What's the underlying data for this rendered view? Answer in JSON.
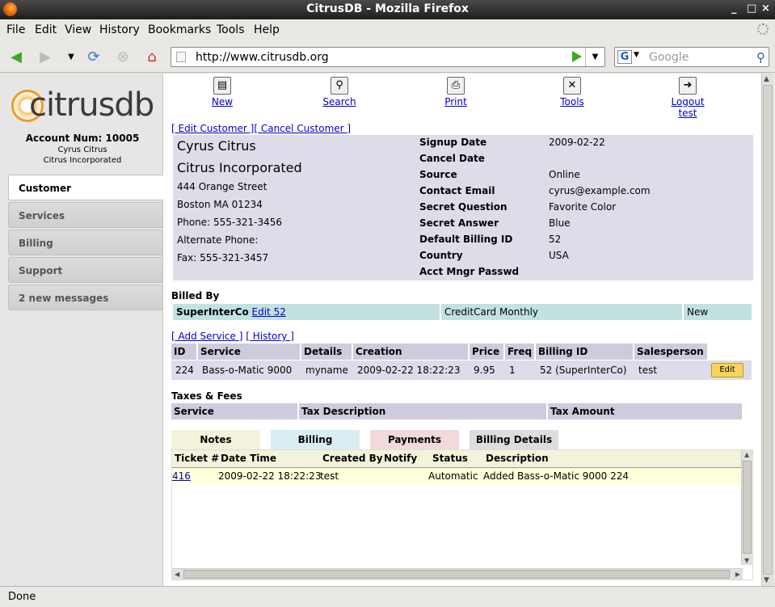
{
  "window": {
    "title": "CitrusDB - Mozilla Firefox"
  },
  "menu": [
    "File",
    "Edit",
    "View",
    "History",
    "Bookmarks",
    "Tools",
    "Help"
  ],
  "nav": {
    "url": "http://www.citrusdb.org",
    "search_placeholder": "Google"
  },
  "status": "Done",
  "sidebar": {
    "brand": "citrusdb",
    "account_label": "Account Num:",
    "account_num": "10005",
    "name": "Cyrus Citrus",
    "company": "Citrus Incorporated",
    "tabs": [
      {
        "label": "Customer"
      },
      {
        "label": "Services"
      },
      {
        "label": "Billing"
      },
      {
        "label": "Support"
      },
      {
        "label": "2 new messages"
      }
    ]
  },
  "toolbar": [
    {
      "label": "New"
    },
    {
      "label": "Search"
    },
    {
      "label": "Print"
    },
    {
      "label": "Tools"
    },
    {
      "label": "Logout test"
    }
  ],
  "customer_links": {
    "edit": "[ Edit Customer ]",
    "cancel": "[ Cancel Customer ]"
  },
  "customer": {
    "name": "Cyrus Citrus",
    "company": "Citrus Incorporated",
    "street": "444 Orange Street",
    "city": "Boston MA 01234",
    "phone": "Phone: 555-321-3456",
    "alt_phone": "Alternate Phone:",
    "fax": "Fax: 555-321-3457"
  },
  "details": [
    {
      "k": "Signup Date",
      "v": "2009-02-22"
    },
    {
      "k": "Cancel Date",
      "v": ""
    },
    {
      "k": "Source",
      "v": "Online"
    },
    {
      "k": "Contact Email",
      "v": "cyrus@example.com"
    },
    {
      "k": "Secret Question",
      "v": "Favorite Color"
    },
    {
      "k": "Secret Answer",
      "v": "Blue"
    },
    {
      "k": "Default Billing ID",
      "v": "52"
    },
    {
      "k": "Country",
      "v": "USA"
    },
    {
      "k": "Acct Mngr Passwd",
      "v": ""
    }
  ],
  "billed_by": {
    "heading": "Billed By",
    "org": "SuperInterCo",
    "edit_link": "Edit 52",
    "method": "CreditCard Monthly",
    "status": "New"
  },
  "service_links": {
    "add": "[ Add Service ]",
    "history": "[ History ]"
  },
  "services": {
    "headers": [
      "ID",
      "Service",
      "Details",
      "Creation",
      "Price",
      "Freq",
      "Billing ID",
      "Salesperson"
    ],
    "rows": [
      [
        "224",
        "Bass-o-Matic 9000",
        "myname",
        "2009-02-22 18:22:23",
        "9.95",
        "1",
        "52 (SuperInterCo)",
        "test"
      ]
    ],
    "edit_label": "Edit"
  },
  "taxes": {
    "heading": "Taxes & Fees",
    "headers": [
      "Service",
      "Tax Description",
      "Tax Amount"
    ]
  },
  "tabs": [
    {
      "label": "Notes",
      "color": "#f3f3dc"
    },
    {
      "label": "Billing",
      "color": "#d9eef2"
    },
    {
      "label": "Payments",
      "color": "#f2dada"
    },
    {
      "label": "Billing Details",
      "color": "#dddddd"
    }
  ],
  "notes": {
    "headers": [
      "Ticket #",
      "Date Time",
      "Created By",
      "Notify",
      "Status",
      "Description"
    ],
    "rows": [
      [
        "416",
        "2009-02-22 18:22:23",
        "test",
        "",
        "Automatic",
        "Added Bass-o-Matic 9000 224"
      ]
    ]
  }
}
